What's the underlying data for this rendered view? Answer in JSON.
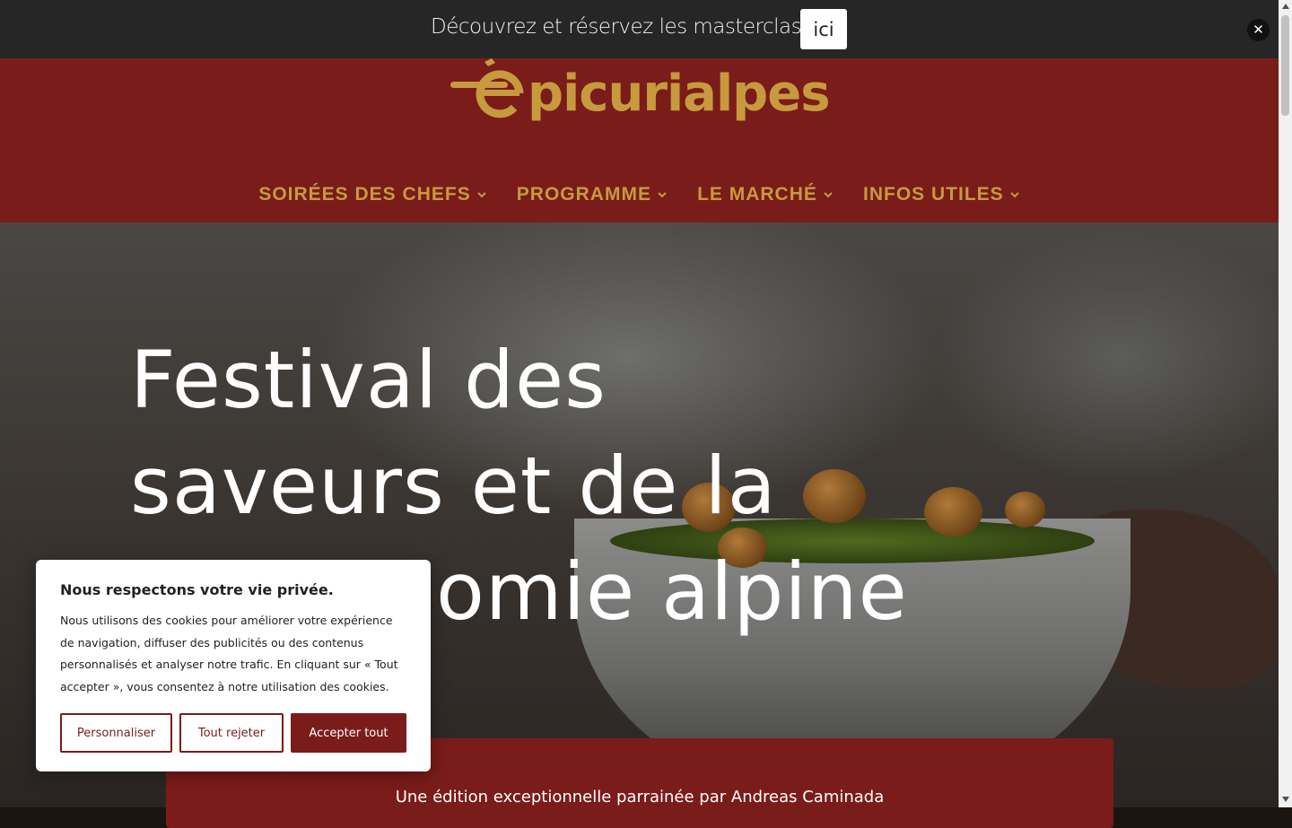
{
  "announcement": {
    "text": "Découvrez et réservez les masterclass",
    "link_label": "ici",
    "close_label": "✕"
  },
  "header": {
    "logo_text": "picurialpes",
    "logo_icon": "e-with-spoon-logo",
    "nav": [
      {
        "label": "SOIRÉES DES CHEFS"
      },
      {
        "label": "PROGRAMME"
      },
      {
        "label": "LE MARCHÉ"
      },
      {
        "label": "INFOS UTILES"
      }
    ],
    "colors": {
      "background": "#7a1c1a",
      "accent": "#c79a3e"
    }
  },
  "hero": {
    "title": "Festival des saveurs et de la gastronomie alpine",
    "edition": "Une édition exceptionnelle parrainée par Andreas Caminada"
  },
  "cookie_banner": {
    "title": "Nous respectons votre vie privée.",
    "body": "Nous utilisons des cookies pour améliorer votre expérience de navigation, diffuser des publicités ou des contenus personnalisés et analyser notre trafic. En cliquant sur « Tout accepter », vous consentez à notre utilisation des cookies.",
    "customize_label": "Personnaliser",
    "reject_label": "Tout rejeter",
    "accept_label": "Accepter tout"
  }
}
